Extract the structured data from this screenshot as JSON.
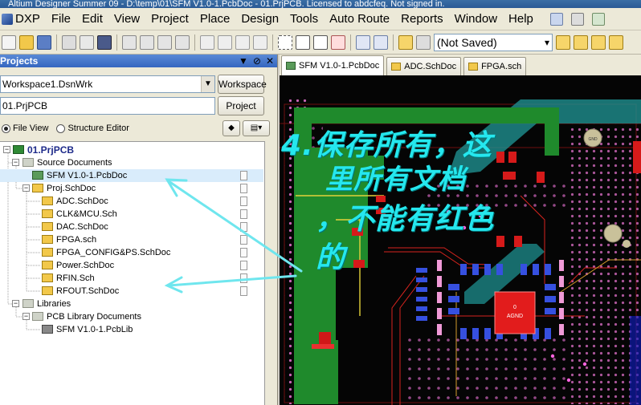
{
  "window": {
    "title": "Altium Designer Summer 09 - D:\\temp\\01\\SFM V1.0-1.PcbDoc - 01.PrjPCB. Licensed to abdcfeq. Not signed in."
  },
  "menu": {
    "items": [
      "DXP",
      "File",
      "Edit",
      "View",
      "Project",
      "Place",
      "Design",
      "Tools",
      "Auto Route",
      "Reports",
      "Window",
      "Help"
    ]
  },
  "toolbar": {
    "view_select": "(Not Saved)"
  },
  "projects_panel": {
    "title": "Projects",
    "workspace_value": "Workspace1.DsnWrk",
    "workspace_button": "Workspace",
    "project_value": "01.PrjPCB",
    "project_button": "Project",
    "view_options": [
      "File View",
      "Structure Editor"
    ],
    "selected_view": "File View"
  },
  "tree": {
    "project": "01.PrjPCB",
    "source_folder": "Source Documents",
    "pcb_doc": "SFM V1.0-1.PcbDoc",
    "sch_root": "Proj.SchDoc",
    "sch_children": [
      "ADC.SchDoc",
      "CLK&MCU.Sch",
      "DAC.SchDoc",
      "FPGA.sch",
      "FPGA_CONFIG&PS.SchDoc",
      "Power.SchDoc",
      "RFIN.Sch",
      "RFOUT.SchDoc"
    ],
    "libraries_folder": "Libraries",
    "pcb_lib_folder": "PCB Library Documents",
    "pcb_lib": "SFM V1.0-1.PcbLib"
  },
  "doc_tabs": [
    "SFM V1.0-1.PcbDoc",
    "ADC.SchDoc",
    "FPGA.sch"
  ],
  "pcb": {
    "chip_label_1": "0",
    "chip_label_2": "AGND",
    "via_label": "GND"
  },
  "annotation": {
    "line1": "4.保存所有，这",
    "line2": "里所有文档",
    "line3": "，不能有红色",
    "line4": "的"
  },
  "colors": {
    "annotation": "#25e7ee",
    "selection": "#d9ecfb",
    "pcb_green": "#1f8a2c"
  }
}
